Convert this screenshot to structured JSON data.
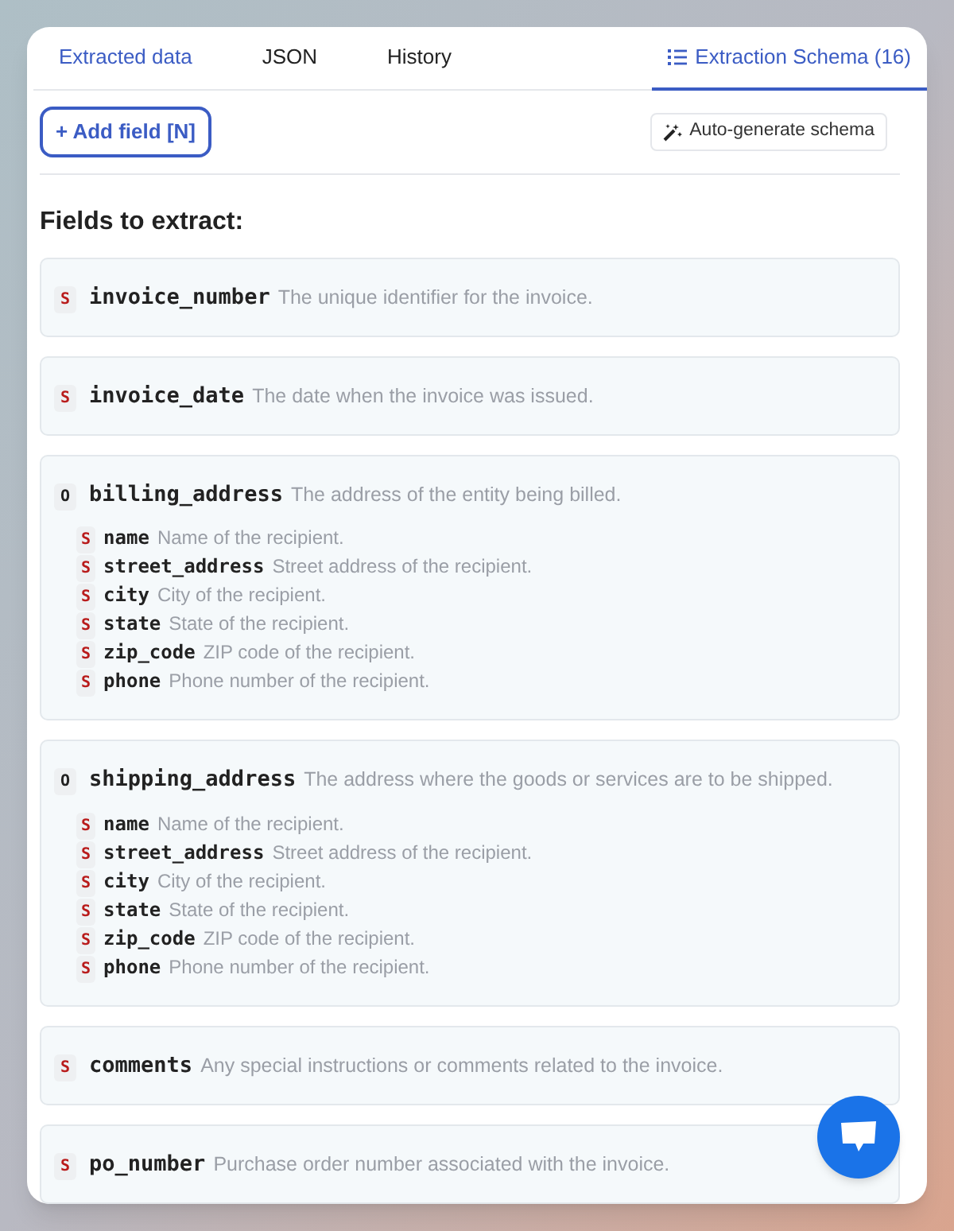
{
  "tabs": [
    {
      "label": "Extracted data",
      "selected": false,
      "kind": "link"
    },
    {
      "label": "JSON",
      "selected": false,
      "kind": "plain"
    },
    {
      "label": "History",
      "selected": false,
      "kind": "plain"
    },
    {
      "label": "Extraction Schema (16)",
      "selected": true,
      "kind": "plain"
    }
  ],
  "toolbar": {
    "add_button": "+ Add field [N]",
    "auto_button": "Auto-generate schema"
  },
  "heading": "Fields to extract:",
  "fields": [
    {
      "badge": "S",
      "kind": "string",
      "name": "invoice_number",
      "description": "The unique identifier for the invoice."
    },
    {
      "badge": "S",
      "kind": "string",
      "name": "invoice_date",
      "description": "The date when the invoice was issued."
    },
    {
      "badge": "O",
      "kind": "object",
      "name": "billing_address",
      "description": "The address of the entity being billed.",
      "children": [
        {
          "badge": "S",
          "kind": "string",
          "name": "name",
          "description": "Name of the recipient."
        },
        {
          "badge": "S",
          "kind": "string",
          "name": "street_address",
          "description": "Street address of the recipient."
        },
        {
          "badge": "S",
          "kind": "string",
          "name": "city",
          "description": "City of the recipient."
        },
        {
          "badge": "S",
          "kind": "string",
          "name": "state",
          "description": "State of the recipient."
        },
        {
          "badge": "S",
          "kind": "string",
          "name": "zip_code",
          "description": "ZIP code of the recipient."
        },
        {
          "badge": "S",
          "kind": "string",
          "name": "phone",
          "description": "Phone number of the recipient."
        }
      ]
    },
    {
      "badge": "O",
      "kind": "object",
      "name": "shipping_address",
      "description": "The address where the goods or services are to be shipped.",
      "children": [
        {
          "badge": "S",
          "kind": "string",
          "name": "name",
          "description": "Name of the recipient."
        },
        {
          "badge": "S",
          "kind": "string",
          "name": "street_address",
          "description": "Street address of the recipient."
        },
        {
          "badge": "S",
          "kind": "string",
          "name": "city",
          "description": "City of the recipient."
        },
        {
          "badge": "S",
          "kind": "string",
          "name": "state",
          "description": "State of the recipient."
        },
        {
          "badge": "S",
          "kind": "string",
          "name": "zip_code",
          "description": "ZIP code of the recipient."
        },
        {
          "badge": "S",
          "kind": "string",
          "name": "phone",
          "description": "Phone number of the recipient."
        }
      ]
    },
    {
      "badge": "S",
      "kind": "string",
      "name": "comments",
      "description": "Any special instructions or comments related to the invoice."
    },
    {
      "badge": "S",
      "kind": "string",
      "name": "po_number",
      "description": "Purchase order number associated with the invoice."
    }
  ]
}
